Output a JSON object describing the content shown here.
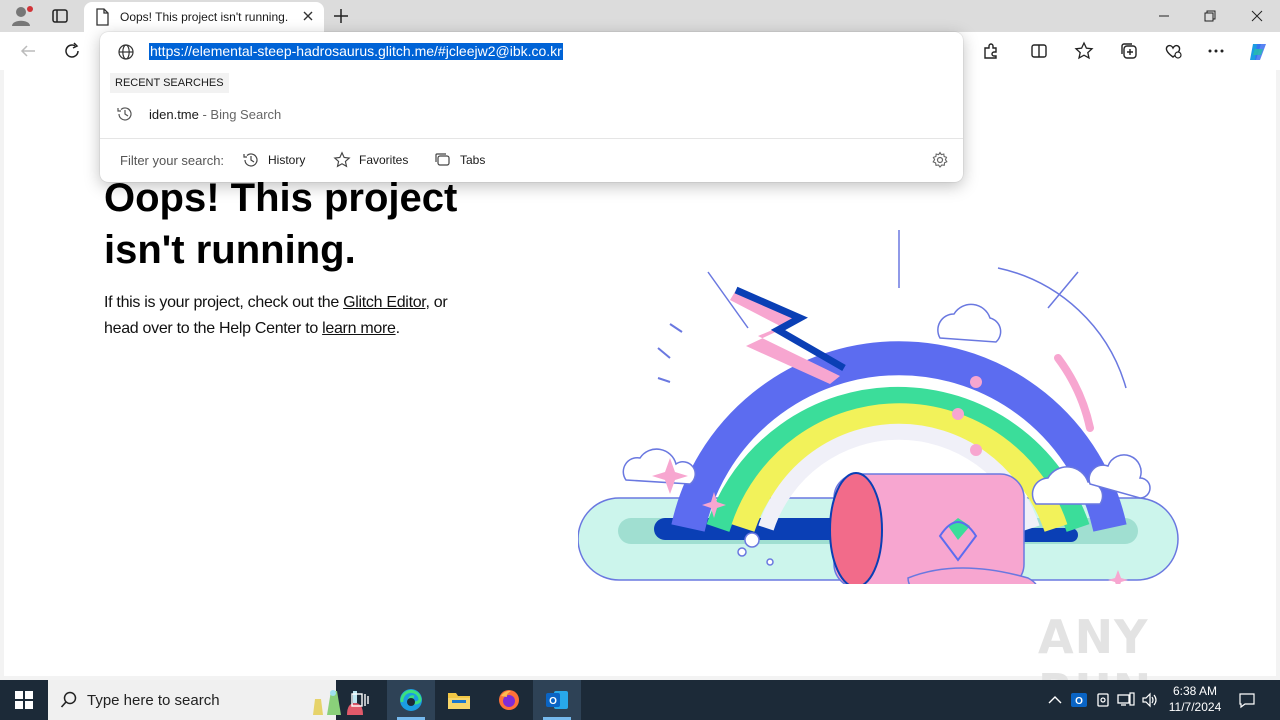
{
  "browser": {
    "tab": {
      "title": "Oops! This project isn't running."
    },
    "omnibox": {
      "url": "https://elemental-steep-hadrosaurus.glitch.me/#jcleejw2@ibk.co.kr",
      "recent_label": "RECENT SEARCHES",
      "recent_items": [
        {
          "query": "iden.tme",
          "suffix": " - Bing Search"
        }
      ],
      "filter_label": "Filter your search:",
      "filters": [
        "History",
        "Favorites",
        "Tabs"
      ]
    }
  },
  "page": {
    "heading": "Oops! This project isn't running.",
    "text_before_link1": "If this is your project, check out the ",
    "link1": "Glitch Editor",
    "text_between": ", or head over to the Help Center to ",
    "link2": "learn more",
    "text_end": "."
  },
  "watermark": "ANY RUN",
  "taskbar": {
    "search_placeholder": "Type here to search",
    "time": "6:38 AM",
    "date": "11/7/2024"
  },
  "colors": {
    "selection": "#0063d6",
    "taskbar": "#1c2a38"
  }
}
